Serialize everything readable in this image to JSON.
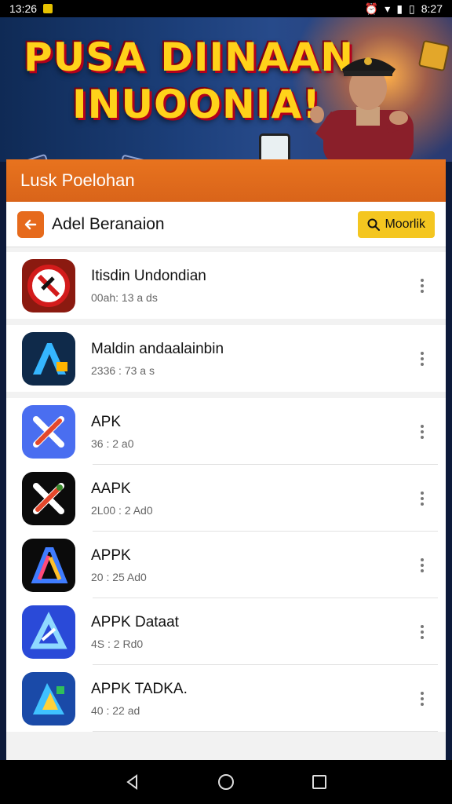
{
  "status_bar": {
    "time_left": "13:26",
    "time_right": "8:27"
  },
  "banner": {
    "title_line1": "PUSA DIINAAN",
    "title_line2": "INUOONIA!"
  },
  "panel": {
    "header_title": "Lusk Poelohan"
  },
  "toolbar": {
    "back_icon": "arrow-left-icon",
    "title": "Adel Beranaion",
    "search_label": "Moorlik"
  },
  "apps": [
    {
      "name": "Itisdin Undondian",
      "meta": "00ah: 13 a ds"
    },
    {
      "name": "Maldin andaalainbin",
      "meta": "2336 : 73 a s"
    },
    {
      "name": "APK",
      "meta": "36 : 2 a0"
    },
    {
      "name": "AAPK",
      "meta": "2L00 : 2 Ad0"
    },
    {
      "name": "APPK",
      "meta": "20 : 25 Ad0"
    },
    {
      "name": "APPK Dataat",
      "meta": "4S : 2 Rd0"
    },
    {
      "name": "APPK TADKA.",
      "meta": "40 : 22 ad"
    }
  ],
  "colors": {
    "accent_orange": "#e66a1c",
    "search_yellow": "#f4c620",
    "banner_text": "#ffd21a"
  }
}
